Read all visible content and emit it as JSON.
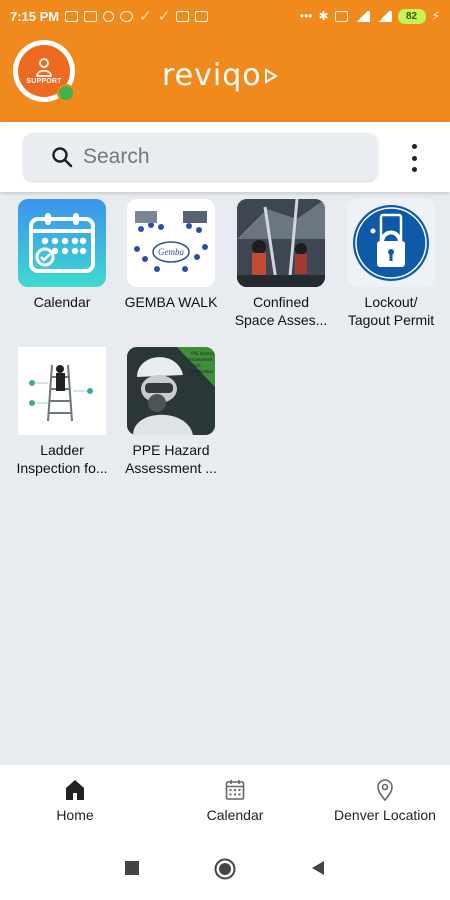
{
  "status_bar": {
    "time": "7:15 PM",
    "battery": "82",
    "icons": [
      "message-icon",
      "message-icon",
      "dot-icon",
      "app-icon",
      "check-icon",
      "check-icon",
      "image-icon",
      "plus-icon",
      "bluetooth-icon",
      "wifi-icon",
      "signal-icon",
      "signal-icon",
      "battery-icon",
      "charging-icon"
    ]
  },
  "header": {
    "support_label": "SUPPORT",
    "brand": "reviqo",
    "brand_color": "#f08a1c"
  },
  "search": {
    "placeholder": "Search"
  },
  "apps": [
    {
      "label": "Calendar"
    },
    {
      "label": "GEMBA WALK"
    },
    {
      "label": "Confined\nSpace Asses..."
    },
    {
      "label": "Lockout/\nTagout Permit"
    },
    {
      "label": "Ladder\nInspection fo..."
    },
    {
      "label": "PPE Hazard\nAssessment ..."
    }
  ],
  "bottom_nav": {
    "items": [
      {
        "label": "Home",
        "icon": "home-icon"
      },
      {
        "label": "Calendar",
        "icon": "calendar-icon"
      },
      {
        "label": "Denver Location",
        "icon": "location-pin-icon"
      }
    ]
  },
  "system_nav": {
    "buttons": [
      "recents-button",
      "home-button",
      "back-button"
    ]
  }
}
